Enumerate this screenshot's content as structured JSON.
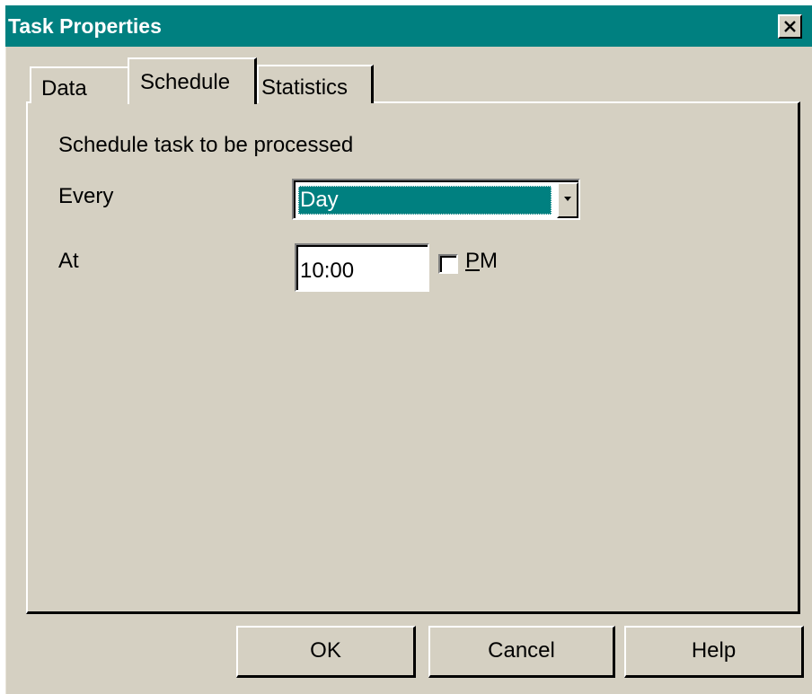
{
  "window": {
    "title": "Task Properties",
    "close_icon": "close-icon",
    "title_bar_color": "#008080",
    "face_color": "#d5d0c2"
  },
  "tabs": [
    {
      "label": "Data",
      "selected": false
    },
    {
      "label": "Schedule",
      "selected": true
    },
    {
      "label": "Statistics",
      "selected": false
    }
  ],
  "schedule": {
    "heading": "Schedule task to be processed",
    "every_label": "Every",
    "every_value": "Day",
    "at_label": "At",
    "at_value": "10:00",
    "pm_label_accel": "P",
    "pm_label_rest": "M",
    "pm_checked": false
  },
  "buttons": {
    "ok": "OK",
    "cancel": "Cancel",
    "help": "Help"
  }
}
